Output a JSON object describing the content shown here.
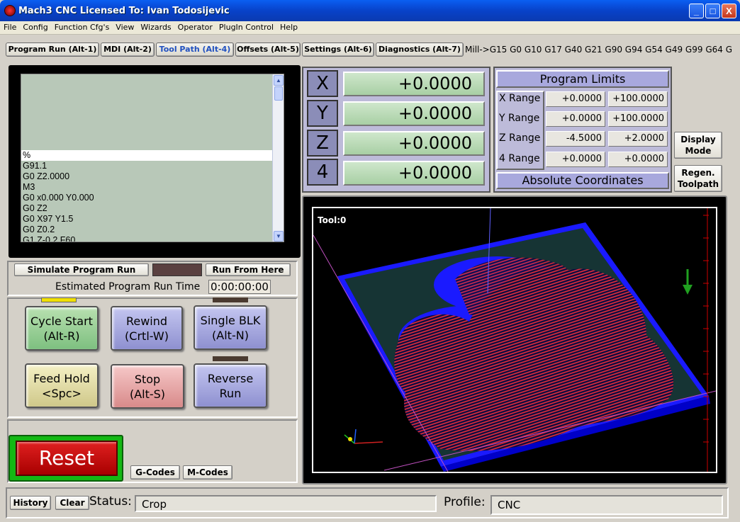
{
  "window": {
    "title": "Mach3 CNC  Licensed To: Ivan Todosijevic",
    "min": "_",
    "max": "□",
    "close": "X"
  },
  "menu": [
    "File",
    "Config",
    "Function Cfg's",
    "View",
    "Wizards",
    "Operator",
    "PlugIn Control",
    "Help"
  ],
  "tabs": [
    {
      "label": "Program Run (Alt-1)"
    },
    {
      "label": "MDI (Alt-2)"
    },
    {
      "label": "Tool Path (Alt-4)"
    },
    {
      "label": "Offsets (Alt-5)"
    },
    {
      "label": "Settings (Alt-6)"
    },
    {
      "label": "Diagnostics (Alt-7)"
    }
  ],
  "modal_line": "Mill->G15  G0 G10 G17 G40 G21 G90 G94 G54 G49 G99 G64 G",
  "gcode": {
    "lines": [
      "%",
      "G91.1",
      "G0 Z2.0000",
      "M3",
      "G0 x0.000 Y0.000",
      "G0 Z2",
      "G0 X97 Y1.5",
      "G0 Z0.2",
      "G1 Z-0.2 F60"
    ],
    "selected_index": 0
  },
  "program_controls": {
    "simulate": "Simulate Program Run",
    "run_from_here": "Run From Here",
    "est_time_label": "Estimated Program Run Time",
    "est_time_value": "0:00:00:00"
  },
  "buttons": {
    "cycle_start": [
      "Cycle Start",
      "(Alt-R)"
    ],
    "rewind": [
      "Rewind",
      "(Crtl-W)"
    ],
    "single_blk": [
      "Single BLK",
      "(Alt-N)"
    ],
    "feed_hold": [
      "Feed Hold",
      "<Spc>"
    ],
    "stop": [
      "Stop",
      "(Alt-S)"
    ],
    "reverse_run": [
      "Reverse",
      "Run"
    ],
    "reset": "Reset",
    "gcodes": "G-Codes",
    "mcodes": "M-Codes"
  },
  "dro": [
    {
      "axis": "X",
      "value": "+0.0000"
    },
    {
      "axis": "Y",
      "value": "+0.0000"
    },
    {
      "axis": "Z",
      "value": "+0.0000"
    },
    {
      "axis": "4",
      "value": "+0.0000"
    }
  ],
  "program_limits": {
    "title": "Program Limits",
    "rows": [
      {
        "label": "X Range",
        "min": "+0.0000",
        "max": "+100.0000"
      },
      {
        "label": "Y Range",
        "min": "+0.0000",
        "max": "+100.0000"
      },
      {
        "label": "Z Range",
        "min": "-4.5000",
        "max": "+2.0000"
      },
      {
        "label": "4 Range",
        "min": "+0.0000",
        "max": "+0.0000"
      }
    ],
    "coords": "Absolute Coordinates"
  },
  "side_buttons": {
    "display_mode": [
      "Display",
      "Mode"
    ],
    "regen": [
      "Regen.",
      "Toolpath"
    ]
  },
  "toolpath": {
    "tool_label": "Tool:0"
  },
  "status": {
    "history": "History",
    "clear": "Clear",
    "status_label": "Status:",
    "status_value": "Crop",
    "profile_label": "Profile:",
    "profile_value": "CNC"
  },
  "colors": {
    "accent": "#0a5ff2",
    "toolpath_stock": "#1010ff",
    "toolpath_cut": "#e8303a",
    "dro_green": "#a8cfa4"
  }
}
